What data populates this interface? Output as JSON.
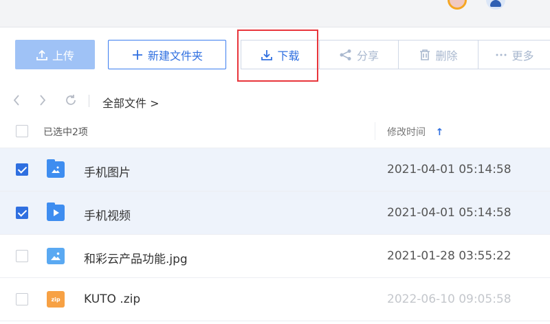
{
  "toolbar": {
    "upload_label": "上传",
    "new_folder_label": "新建文件夹",
    "download_label": "下载",
    "share_label": "分享",
    "delete_label": "删除",
    "more_label": "更多"
  },
  "nav": {
    "breadcrumb": "全部文件 >"
  },
  "list_header": {
    "selection_text": "已选中2项",
    "time_column": "修改时间",
    "sort_indicator": "↑"
  },
  "files": [
    {
      "name": "手机图片",
      "modified": "2021-04-01 05:14:58",
      "type": "image-folder",
      "selected": true
    },
    {
      "name": "手机视频",
      "modified": "2021-04-01 05:14:58",
      "type": "video-folder",
      "selected": true
    },
    {
      "name": "和彩云产品功能.jpg",
      "modified": "2021-01-28 03:55:22",
      "type": "image",
      "selected": false
    },
    {
      "name": "KUTO .zip",
      "modified": "2022-06-10 09:05:58",
      "type": "zip",
      "selected": false
    }
  ],
  "icons": {
    "zip_text": "zip"
  },
  "colors": {
    "accent": "#2f6fe0",
    "highlight": "#e8343a",
    "selected_row": "#eef3fb",
    "folder": "#3e8df0",
    "zip": "#f7a144"
  }
}
